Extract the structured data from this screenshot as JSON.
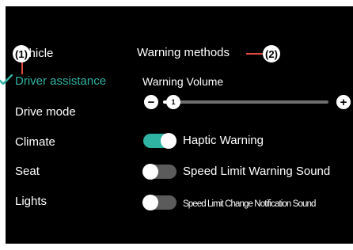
{
  "sidebar": {
    "items": [
      {
        "label": "Vehicle",
        "active": false
      },
      {
        "label": "Driver assistance",
        "active": true
      },
      {
        "label": "Drive mode",
        "active": false
      },
      {
        "label": "Climate",
        "active": false
      },
      {
        "label": "Seat",
        "active": false
      },
      {
        "label": "Lights",
        "active": false
      }
    ]
  },
  "callouts": {
    "one": "(1)",
    "two": "(2)"
  },
  "main": {
    "section_title": "Warning methods",
    "volume": {
      "label": "Warning Volume",
      "minus_symbol": "−",
      "plus_symbol": "+",
      "value": "1",
      "level_fraction": 0.06
    },
    "toggles": [
      {
        "label": "Haptic Warning",
        "on": true
      },
      {
        "label": "Speed Limit Warning Sound",
        "on": false
      },
      {
        "label": "Speed Limit Change Notification Sound",
        "on": false
      }
    ]
  },
  "colors": {
    "accent": "#2fb3a3",
    "background": "#000000",
    "text": "#ffffff",
    "callout_line": "#e24a3b",
    "toggle_off": "#5b5b5b"
  },
  "icons": {
    "active_marker": "check-icon",
    "volume_down": "minus-icon",
    "volume_up": "plus-icon"
  }
}
